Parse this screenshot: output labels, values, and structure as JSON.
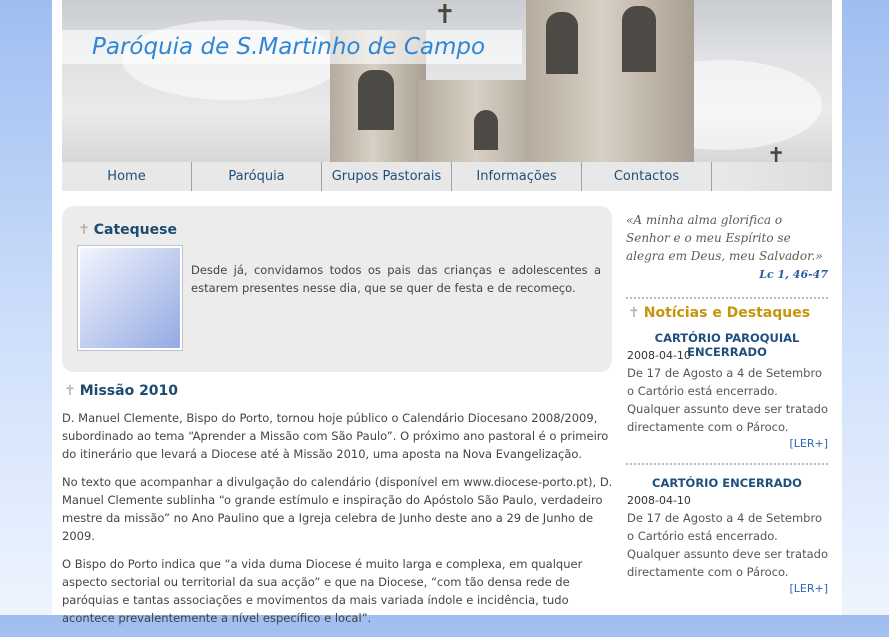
{
  "header": {
    "site_title": "Paróquia de S.Martinho de Campo"
  },
  "nav": {
    "items": [
      {
        "label": "Home"
      },
      {
        "label": "Paróquia"
      },
      {
        "label": "Grupos Pastorais"
      },
      {
        "label": "Informações"
      },
      {
        "label": "Contactos"
      }
    ]
  },
  "main": {
    "catequese": {
      "title": "Catequese",
      "text": "Desde já, convidamos todos os pais das crianças e adolescentes a estarem presentes nesse dia, que se quer de festa e de recomeço."
    },
    "missao": {
      "title": "Missão 2010",
      "paragraphs": [
        "D. Manuel Clemente, Bispo do Porto, tornou hoje público o Calendário Diocesano 2008/2009, subordinado ao tema “Aprender a Missão com São Paulo”. O próximo ano pastoral é o primeiro do itinerário que levará a Diocese até à Missão 2010, uma aposta na Nova Evangelização.",
        "No texto que acompanhar a divulgação do calendário (disponível em www.diocese-porto.pt), D. Manuel Clemente sublinha “o grande estímulo e inspiração do Apóstolo São Paulo, verdadeiro mestre da missão” no Ano Paulino que a Igreja celebra de Junho deste ano a 29 de Junho de 2009.",
        "O Bispo do Porto indica que “a vida duma Diocese é muito larga e complexa, em qualquer aspecto sectorial ou territorial da sua acção” e que na Diocese, “com tão densa rede de paróquias e tantas associações e movimentos da mais variada índole e incidência, tudo acontece prevalentemente a nível específico e local”."
      ]
    }
  },
  "sidebar": {
    "quote": "«A minha alma glorifica o Senhor e o meu Espírito se alegra em Deus, meu Salvador.»",
    "quote_ref": "Lc 1, 46-47",
    "news_heading": "Notícias e Destaques",
    "news": [
      {
        "title": "CARTÓRIO PAROQUIAL ENCERRADO",
        "date": "2008-04-10",
        "body": "De 17 de Agosto a 4 de Setembro o Cartório está encerrado. Qualquer assunto deve ser tratado directamente com o Pároco.",
        "more": "[LER+]"
      },
      {
        "title": "CARTÓRIO ENCERRADO",
        "date": "2008-04-10",
        "body": "De 17 de Agosto a 4 de Setembro o Cartório está encerrado. Qualquer assunto deve ser tratado directamente com o Pároco.",
        "more": "[LER+]"
      }
    ]
  },
  "icons": {
    "heading_mark": "cross-icon"
  }
}
